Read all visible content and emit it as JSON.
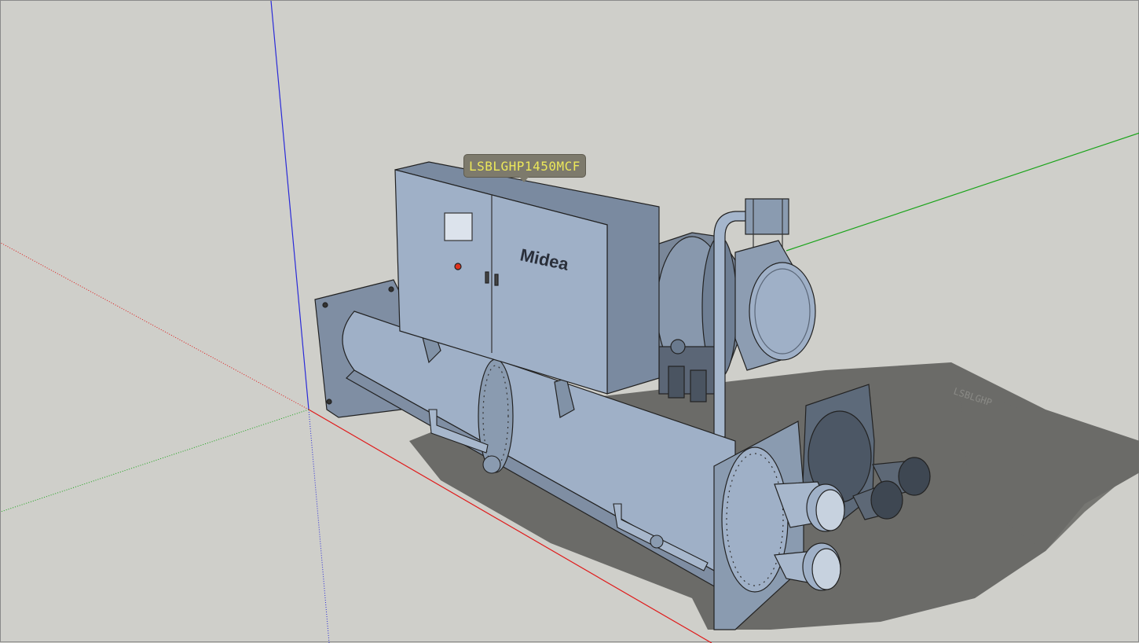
{
  "model": {
    "label": "LSBLGHP1450MCF",
    "brand": "Midea",
    "shadow_label": "LSBLGHP"
  },
  "colors": {
    "background": "#cfcfca",
    "body": "#9fb0c7",
    "body_dark": "#6f7f94",
    "shadow": "#6b6b68",
    "axis_red": "#e01a1a",
    "axis_green": "#1aa41a",
    "axis_blue": "#2a2ad8",
    "tag_bg": "#7d7a6c",
    "tag_text": "#ece85a"
  }
}
